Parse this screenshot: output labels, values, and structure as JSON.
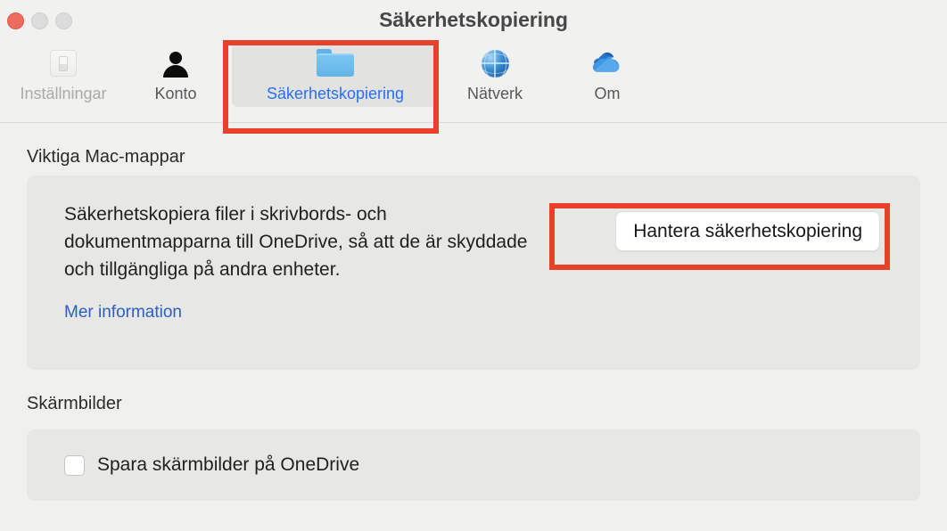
{
  "window": {
    "title": "Säkerhetskopiering",
    "traffic_lights": [
      {
        "name": "close",
        "color": "#ec6a5e"
      },
      {
        "name": "minimize",
        "color": "#dcdcdc"
      },
      {
        "name": "maximize",
        "color": "#dcdcdc"
      }
    ]
  },
  "toolbar": {
    "tabs": [
      {
        "label": "Inställningar",
        "icon": "switch-icon",
        "state": "disabled",
        "selected": false
      },
      {
        "label": "Konto",
        "icon": "person-icon",
        "state": "normal",
        "selected": false
      },
      {
        "label": "Säkerhetskopiering",
        "icon": "folder-icon",
        "state": "active",
        "selected": true
      },
      {
        "label": "Nätverk",
        "icon": "globe-icon",
        "state": "normal",
        "selected": false
      },
      {
        "label": "Om",
        "icon": "onedrive-cloud-icon",
        "state": "normal",
        "selected": false
      }
    ]
  },
  "main": {
    "folders_section": {
      "title": "Viktiga Mac-mappar",
      "description": "Säkerhetskopiera filer i skrivbords- och dokumentmapparna till OneDrive, så att de är skyddade och tillgängliga på andra enheter.",
      "link": "Mer information",
      "button": "Hantera säkerhetskopiering"
    },
    "screenshots_section": {
      "title": "Skärmbilder",
      "checkbox_label": "Spara skärmbilder på OneDrive",
      "checked": false
    }
  },
  "annotations": {
    "color": "#e8402a",
    "boxes": [
      {
        "target": "Säkerhetskopiering tab"
      },
      {
        "target": "Hantera säkerhetskopiering button"
      }
    ]
  }
}
